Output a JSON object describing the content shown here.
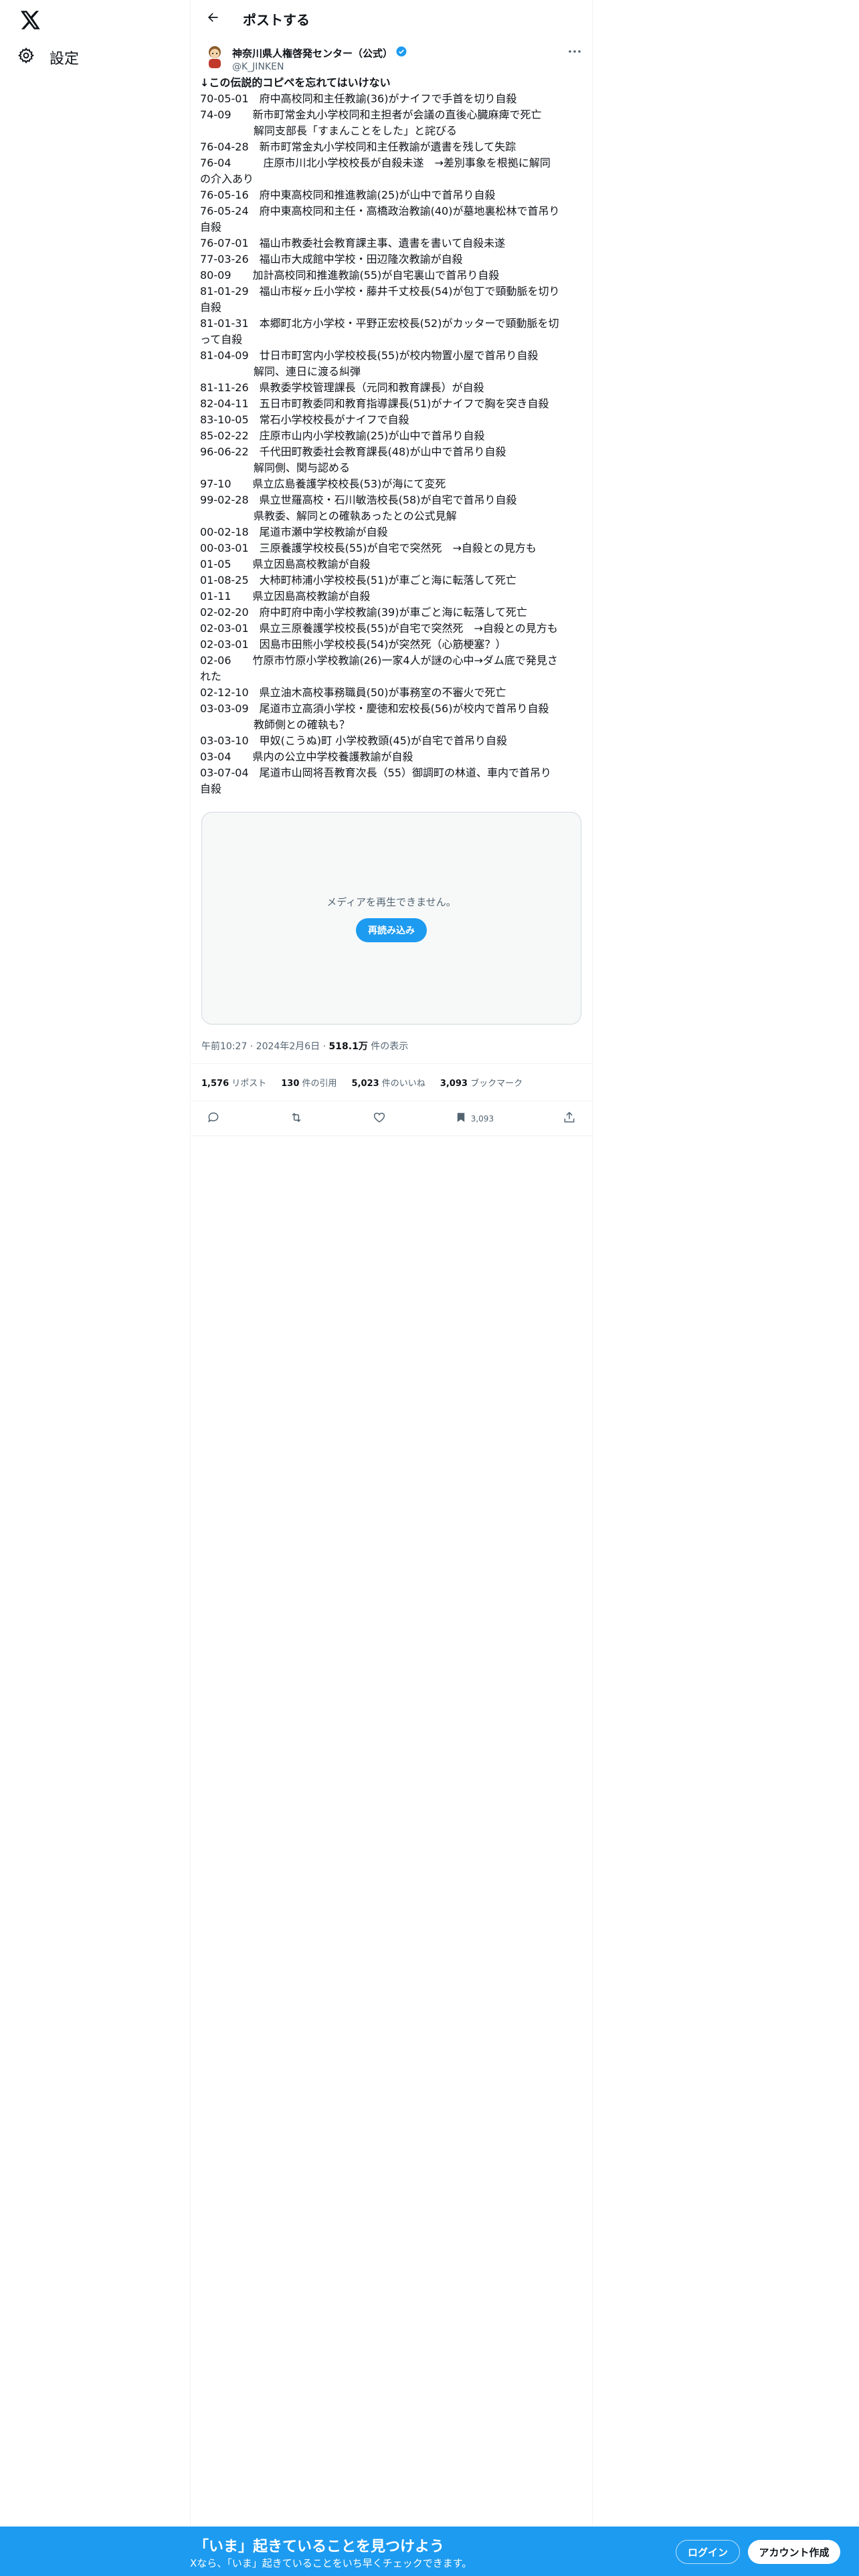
{
  "nav": {
    "settings_label": "設定"
  },
  "header": {
    "title": "ポストする"
  },
  "author": {
    "name": "神奈川県人権啓発センター（公式）",
    "handle": "@K_JINKEN"
  },
  "tweet": {
    "lines": [
      "↓この伝説的コピペを忘れてはいけない",
      "70-05-01　府中高校同和主任教諭(36)がナイフで手首を切り自殺",
      "74-09　　新市町常金丸小学校同和主担者が会議の直後心臓麻痺で死亡",
      "　　　　　解同支部長「すまんことをした」と詫びる",
      "76-04-28　新市町常金丸小学校同和主任教諭が遺書を残して失踪",
      "76-04　　　庄原市川北小学校校長が自殺未遂　→差別事象を根拠に解同",
      "の介入あり",
      "76-05-16　府中東高校同和推進教諭(25)が山中で首吊り自殺",
      "76-05-24　府中東高校同和主任・高橋政治教諭(40)が墓地裏松林で首吊り",
      "自殺",
      "76-07-01　福山市教委社会教育課主事、遺書を書いて自殺未遂",
      "77-03-26　福山市大成館中学校・田辺隆次教諭が自殺",
      "80-09　　加計高校同和推進教諭(55)が自宅裏山で首吊り自殺",
      "81-01-29　福山市桜ヶ丘小学校・藤井千丈校長(54)が包丁で頸動脈を切り",
      "自殺",
      "81-01-31　本郷町北方小学校・平野正宏校長(52)がカッターで頸動脈を切",
      "って自殺",
      "81-04-09　廿日市町宮内小学校校長(55)が校内物置小屋で首吊り自殺",
      "　　　　　解同、連日に渡る糾弾",
      "81-11-26　県教委学校管理課長（元同和教育課長）が自殺",
      "82-04-11　五日市町教委同和教育指導課長(51)がナイフで胸を突き自殺",
      "83-10-05　常石小学校校長がナイフで自殺",
      "85-02-22　庄原市山内小学校教諭(25)が山中で首吊り自殺",
      "96-06-22　千代田町教委社会教育課長(48)が山中で首吊り自殺",
      "　　　　　解同側、関与認める",
      "97-10　　県立広島養護学校校長(53)が海にて変死",
      "99-02-28　県立世羅高校・石川敏浩校長(58)が自宅で首吊り自殺",
      "　　　　　県教委、解同との確執あったとの公式見解",
      "00-02-18　尾道市瀬中学校教諭が自殺",
      "00-03-01　三原養護学校校長(55)が自宅で突然死　→自殺との見方も",
      "01-05　　県立因島高校教諭が自殺",
      "01-08-25　大柿町柿浦小学校校長(51)が車ごと海に転落して死亡",
      "01-11　　県立因島高校教諭が自殺",
      "02-02-20　府中町府中南小学校教諭(39)が車ごと海に転落して死亡",
      "02-03-01　県立三原養護学校校長(55)が自宅で突然死　→自殺との見方も",
      "02-03-01　因島市田熊小学校校長(54)が突然死（心筋梗塞？）",
      "02-06　　竹原市竹原小学校教諭(26)一家4人が謎の心中→ダム底で発見さ",
      "れた",
      "02-12-10　県立油木高校事務職員(50)が事務室の不審火で死亡",
      "03-03-09　尾道市立高須小学校・慶徳和宏校長(56)が校内で首吊り自殺",
      "　　　　　教師側との確執も？",
      "03-03-10　甲奴(こうぬ)町 小学校教頭(45)が自宅で首吊り自殺",
      "03-04　　県内の公立中学校養護教諭が自殺",
      "03-07-04　尾道市山岡将吾教育次長（55）御調町の林道、車内で首吊り",
      "自殺"
    ]
  },
  "media": {
    "message": "メディアを再生できません。",
    "reload_label": "再読み込み"
  },
  "meta": {
    "time": "午前10:27",
    "sep1": " · ",
    "date": "2024年2月6日",
    "sep2": " · ",
    "views_count": "518.1万",
    "views_label": " 件の表示"
  },
  "stats": {
    "reposts_count": "1,576",
    "reposts_label": " リポスト",
    "quotes_count": "130",
    "quotes_label": " 件の引用",
    "likes_count": "5,023",
    "likes_label": " 件のいいね",
    "bookmarks_count": "3,093",
    "bookmarks_label": " ブックマーク"
  },
  "actions": {
    "bookmark_count": "3,093"
  },
  "banner": {
    "title": "「いま」起きていることを見つけよう",
    "subtitle": "Xなら、「いま」起きていることをいち早くチェックできます。",
    "login_label": "ログイン",
    "signup_label": "アカウント作成"
  },
  "colors": {
    "accent": "#1d9bf0",
    "text": "#0f1419",
    "secondary": "#536471",
    "border": "#eff3f4"
  }
}
